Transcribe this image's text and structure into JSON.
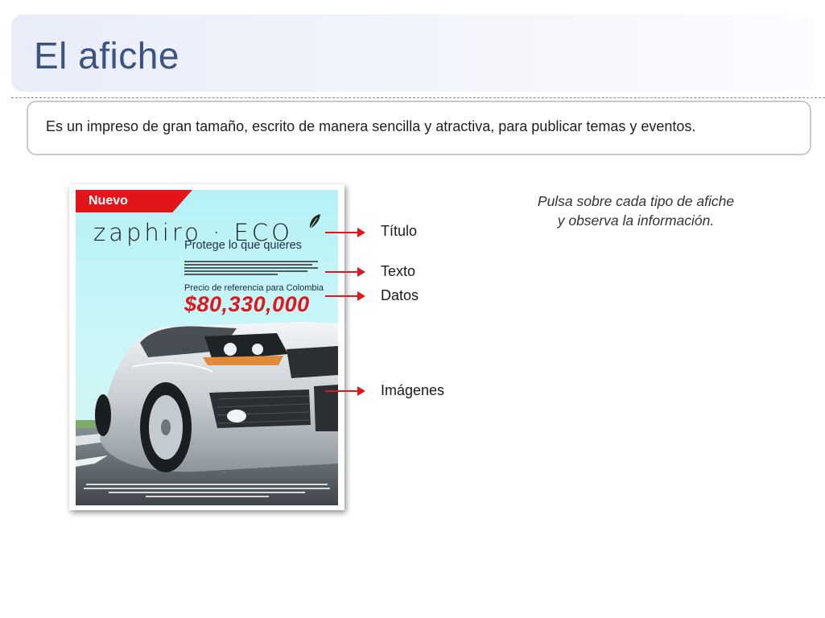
{
  "header": {
    "title": "El afiche"
  },
  "definition": {
    "text": "Es un impreso de gran tamaño, escrito de manera sencilla y atractiva, para publicar temas y eventos."
  },
  "poster": {
    "badge": "Nuevo",
    "brand": "zaphiro · ECO",
    "tagline": "Protege lo que quieres",
    "price_label": "Precio de referencia para Colombia",
    "price": "$80,330,000"
  },
  "labels": {
    "title": "Título",
    "text": "Texto",
    "data": "Datos",
    "images": "Imágenes"
  },
  "hint": {
    "line1": "Pulsa sobre cada tipo de afiche",
    "line2": "y observa la información."
  },
  "colors": {
    "accent_red": "#e3151b",
    "title_blue": "#3a5383",
    "sky": "#b6f1f6"
  }
}
